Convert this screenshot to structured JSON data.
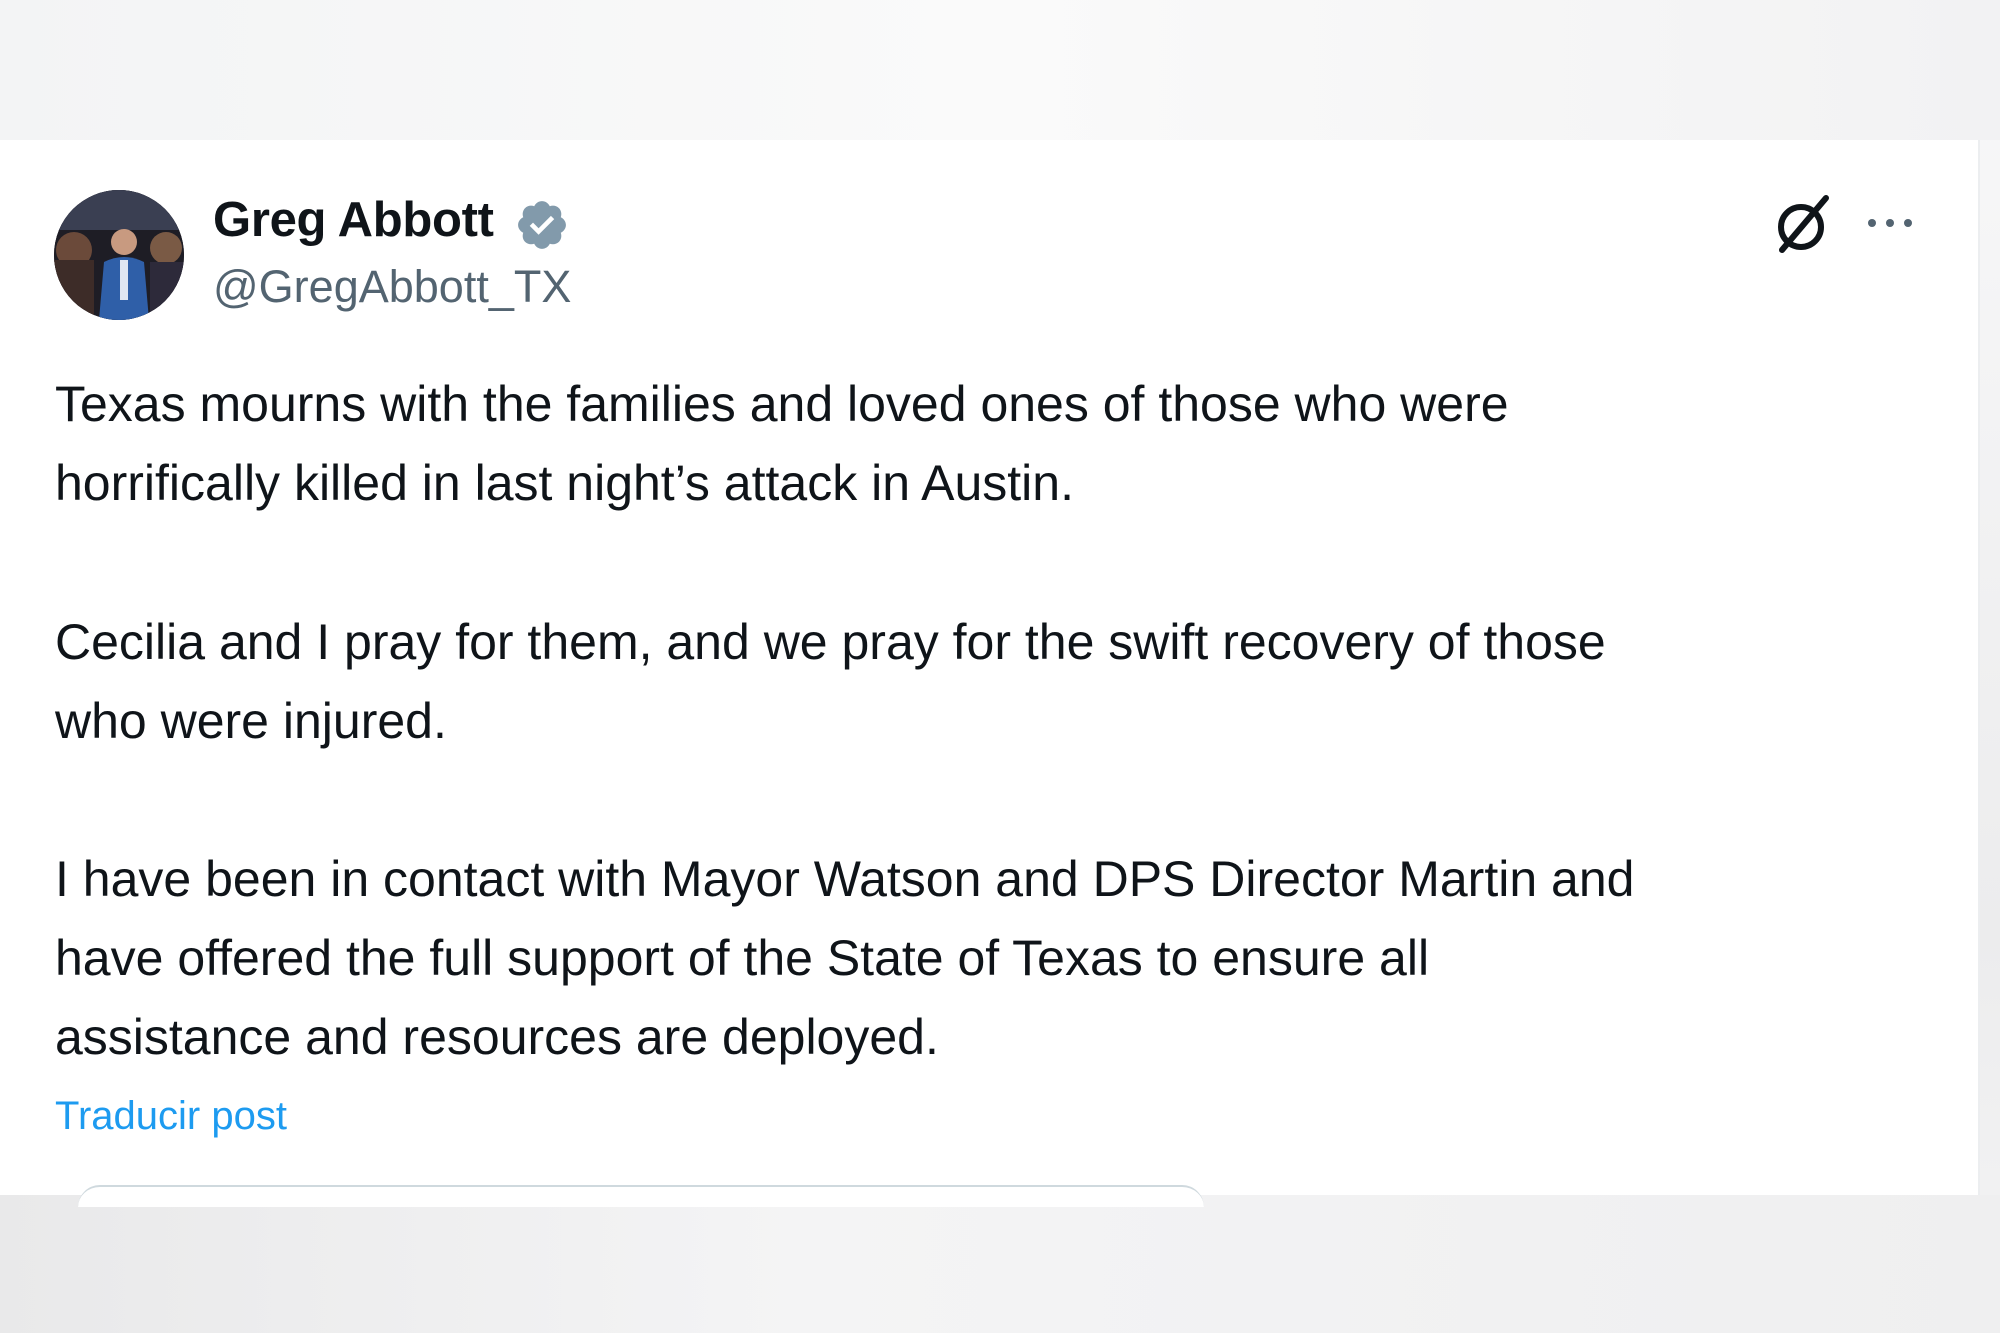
{
  "author": {
    "name": "Greg Abbott",
    "handle": "@GregAbbott_TX",
    "verified": true,
    "verified_icon": "verified-badge-icon",
    "avatar": "profile-photo"
  },
  "actions": {
    "grok_icon": "grok-icon",
    "more_icon": "more-options-icon"
  },
  "post": {
    "paragraphs": [
      {
        "lines": [
          "Texas mourns with the families and loved ones of those who were",
          "horrifically killed in last night’s attack in Austin."
        ]
      },
      {
        "lines": [
          "Cecilia and I pray for them, and we pray for the swift recovery of those",
          "who were injured."
        ]
      },
      {
        "lines": [
          "I have been in contact with Mayor Watson and DPS Director Martin and",
          "have offered the full support of the State of Texas to ensure all",
          "assistance and resources are deployed."
        ]
      }
    ],
    "translate_label": "Traducir post"
  },
  "colors": {
    "text": "#0f1419",
    "secondary": "#536471",
    "link": "#1d9bf0",
    "verified_badge": "#829aab"
  }
}
